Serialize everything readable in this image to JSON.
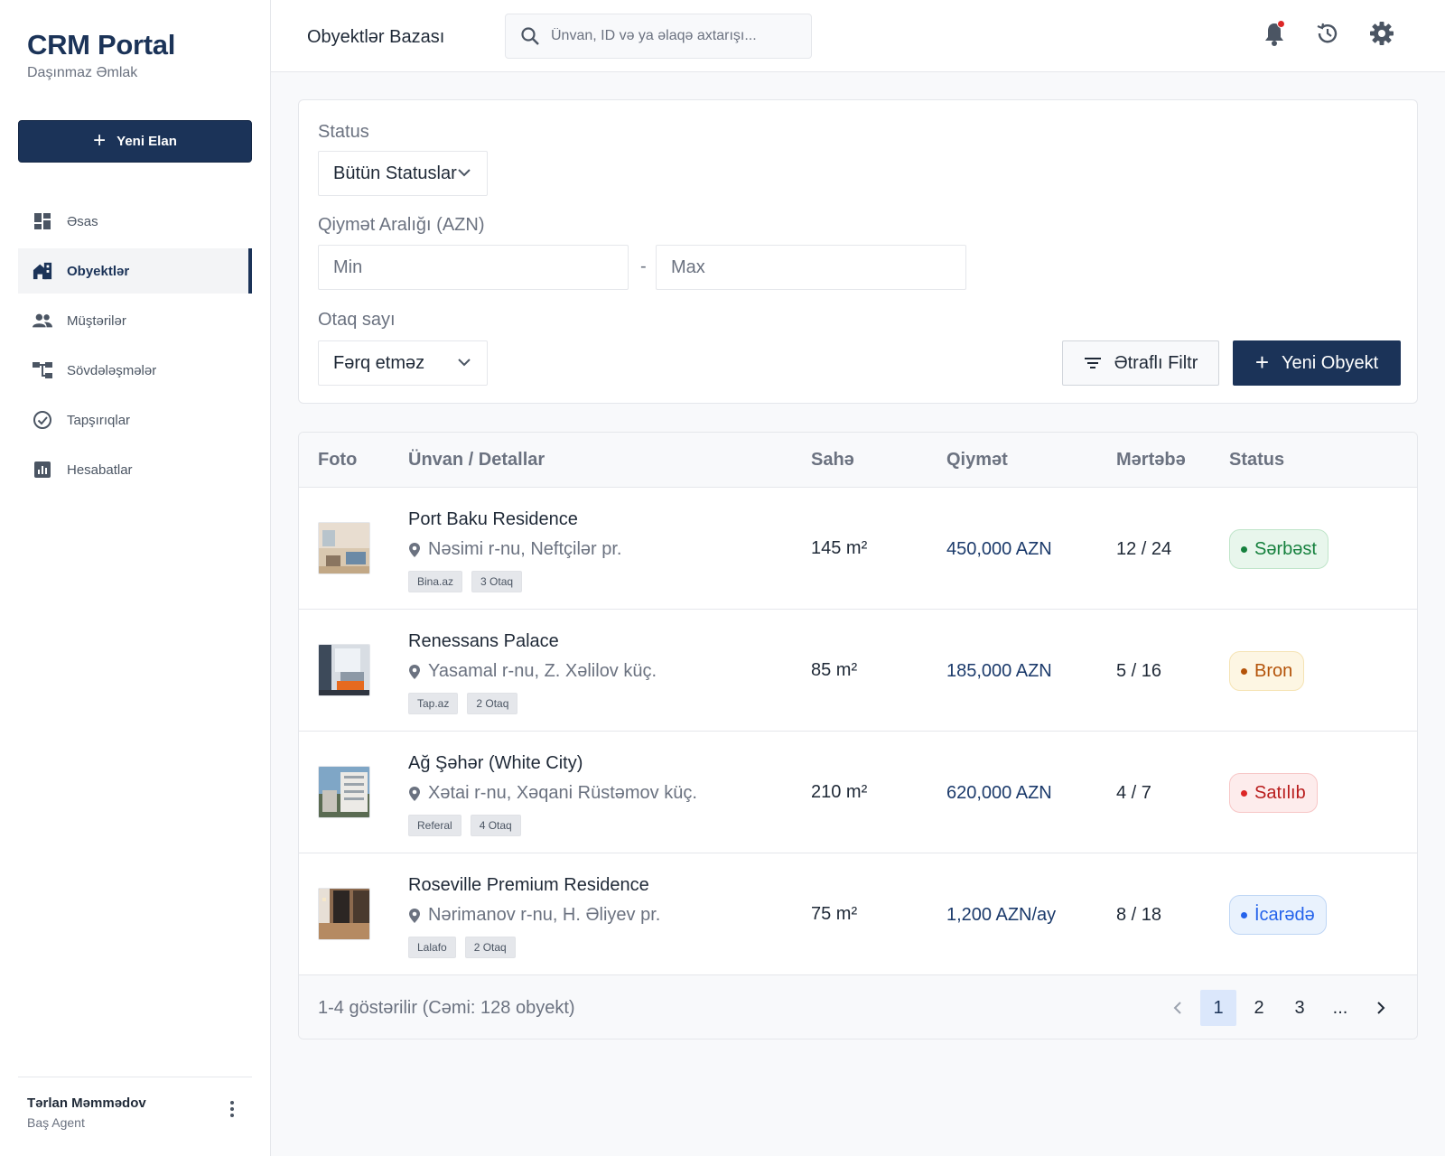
{
  "brand": {
    "title": "CRM Portal",
    "subtitle": "Daşınmaz Əmlak"
  },
  "sidebar": {
    "new_listing_label": "Yeni Elan",
    "items": [
      {
        "label": "Əsas",
        "icon": "dashboard-icon",
        "active": false
      },
      {
        "label": "Obyektlər",
        "icon": "home-work-icon",
        "active": true
      },
      {
        "label": "Müştərilər",
        "icon": "people-icon",
        "active": false
      },
      {
        "label": "Sövdələşmələr",
        "icon": "hierarchy-icon",
        "active": false
      },
      {
        "label": "Tapşırıqlar",
        "icon": "check-circle-icon",
        "active": false
      },
      {
        "label": "Hesabatlar",
        "icon": "report-chart-icon",
        "active": false
      }
    ],
    "user": {
      "name": "Tərlan Məmmədov",
      "role": "Baş Agent"
    }
  },
  "header": {
    "title": "Obyektlər Bazası",
    "search_placeholder": "Ünvan, ID və ya əlaqə axtarışı...",
    "icons": [
      "bell-icon",
      "history-icon",
      "gear-icon"
    ]
  },
  "filters": {
    "status_label": "Status",
    "status_value": "Bütün Statuslar",
    "price_label": "Qiymət Aralığı (AZN)",
    "min_placeholder": "Min",
    "max_placeholder": "Max",
    "separator": "-",
    "rooms_label": "Otaq sayı",
    "rooms_value": "Fərq etməz",
    "advanced_label": "Ətraflı Filtr",
    "new_object_label": "Yeni Obyekt"
  },
  "table": {
    "columns": [
      "Foto",
      "Ünvan / Detallar",
      "Sahə",
      "Qiymət",
      "Mərtəbə",
      "Status"
    ],
    "rows": [
      {
        "title": "Port Baku Residence",
        "address": "Nəsimi r-nu, Neftçilər pr.",
        "tags": [
          "Bina.az",
          "3 Otaq"
        ],
        "area": "145 m²",
        "price": "450,000 AZN",
        "floor": "12 / 24",
        "status": "Sərbəst",
        "status_kind": "free"
      },
      {
        "title": "Renessans Palace",
        "address": "Yasamal r-nu, Z. Xəlilov küç.",
        "tags": [
          "Tap.az",
          "2 Otaq"
        ],
        "area": "85 m²",
        "price": "185,000 AZN",
        "floor": "5 / 16",
        "status": "Bron",
        "status_kind": "bron"
      },
      {
        "title": "Ağ Şəhər (White City)",
        "address": "Xətai r-nu, Xəqani Rüstəmov küç.",
        "tags": [
          "Referal",
          "4 Otaq"
        ],
        "area": "210 m²",
        "price": "620,000 AZN",
        "floor": "4 / 7",
        "status": "Satılıb",
        "status_kind": "sold"
      },
      {
        "title": "Roseville Premium Residence",
        "address": "Nərimanov r-nu, H. Əliyev pr.",
        "tags": [
          "Lalafo",
          "2 Otaq"
        ],
        "area": "75 m²",
        "price": "1,200 AZN/ay",
        "floor": "8 / 18",
        "status": "İcarədə",
        "status_kind": "rent"
      }
    ],
    "footer_text": "1-4 göstərilir (Cəmi: 128 obyekt)",
    "pages": [
      "1",
      "2",
      "3",
      "..."
    ],
    "current_page": "1"
  },
  "colors": {
    "primary": "#1b3358",
    "price": "#1b3a6b",
    "free": "#15803d",
    "bron": "#b45309",
    "sold": "#b91c1c",
    "rent": "#2563eb"
  }
}
